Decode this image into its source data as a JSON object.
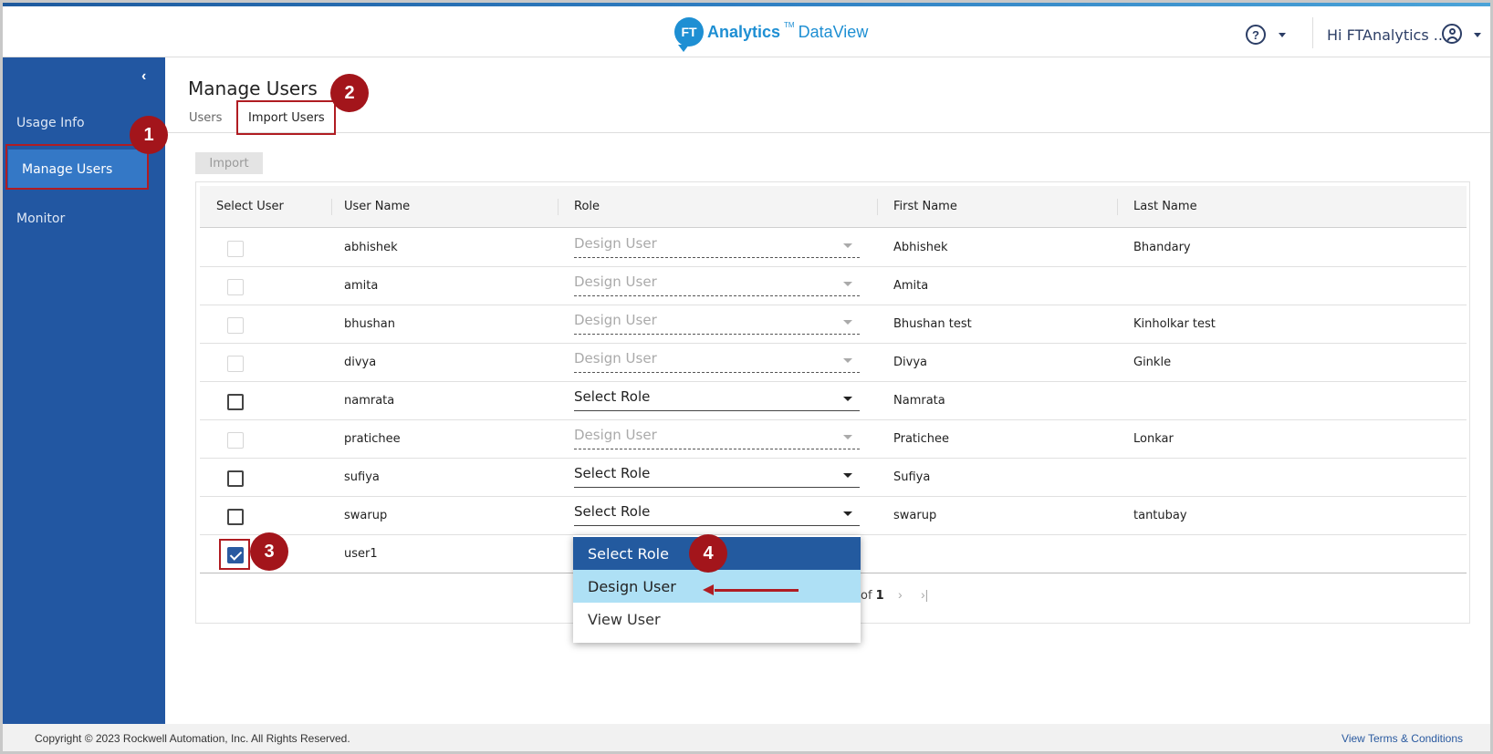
{
  "brand": {
    "logo_badge": "FT",
    "logo_analytics": "Analytics",
    "logo_tm": "TM",
    "logo_dataview": "DataView",
    "color": "#1e8fd3"
  },
  "header": {
    "help_icon": "?",
    "greeting": "Hi FTAnalytics ..."
  },
  "sidebar": {
    "collapse_icon": "‹",
    "items": [
      {
        "label": "Usage Info"
      },
      {
        "label": "Manage Users"
      },
      {
        "label": "Monitor"
      }
    ]
  },
  "page": {
    "title": "Manage Users",
    "tabs": [
      {
        "label": "Users"
      },
      {
        "label": "Import Users"
      }
    ],
    "import_button": "Import"
  },
  "table": {
    "columns": [
      "Select User",
      "User Name",
      "Role",
      "First Name",
      "Last Name"
    ],
    "rows": [
      {
        "checkbox": "disabled",
        "user": "abhishek",
        "role": "Design User",
        "role_enabled": false,
        "first": "Abhishek",
        "last": "Bhandary"
      },
      {
        "checkbox": "disabled",
        "user": "amita",
        "role": "Design User",
        "role_enabled": false,
        "first": "Amita",
        "last": ""
      },
      {
        "checkbox": "disabled",
        "user": "bhushan",
        "role": "Design User",
        "role_enabled": false,
        "first": "Bhushan test",
        "last": "Kinholkar test"
      },
      {
        "checkbox": "disabled",
        "user": "divya",
        "role": "Design User",
        "role_enabled": false,
        "first": "Divya",
        "last": "Ginkle"
      },
      {
        "checkbox": "unchecked",
        "user": "namrata",
        "role": "Select Role",
        "role_enabled": true,
        "first": "Namrata",
        "last": ""
      },
      {
        "checkbox": "disabled",
        "user": "pratichee",
        "role": "Design User",
        "role_enabled": false,
        "first": "Pratichee",
        "last": "Lonkar"
      },
      {
        "checkbox": "unchecked",
        "user": "sufiya",
        "role": "Select Role",
        "role_enabled": true,
        "first": "Sufiya",
        "last": ""
      },
      {
        "checkbox": "unchecked",
        "user": "swarup",
        "role": "Select Role",
        "role_enabled": true,
        "first": "swarup",
        "last": "tantubay"
      },
      {
        "checkbox": "checked",
        "user": "user1",
        "role": "",
        "role_enabled": true,
        "first": "",
        "last": ""
      }
    ]
  },
  "pager": {
    "prefix": "of",
    "total": "1",
    "next_icon": "›",
    "last_icon": "›|"
  },
  "role_menu": {
    "options": [
      "Select Role",
      "Design User",
      "View User"
    ],
    "selected": "Select Role",
    "highlighted": "Design User"
  },
  "annotations": {
    "steps": [
      "1",
      "2",
      "3",
      "4"
    ],
    "color": "#b01c22"
  },
  "footer": {
    "copyright": "Copyright © 2023 Rockwell Automation, Inc. All Rights Reserved.",
    "terms": "View Terms & Conditions"
  }
}
